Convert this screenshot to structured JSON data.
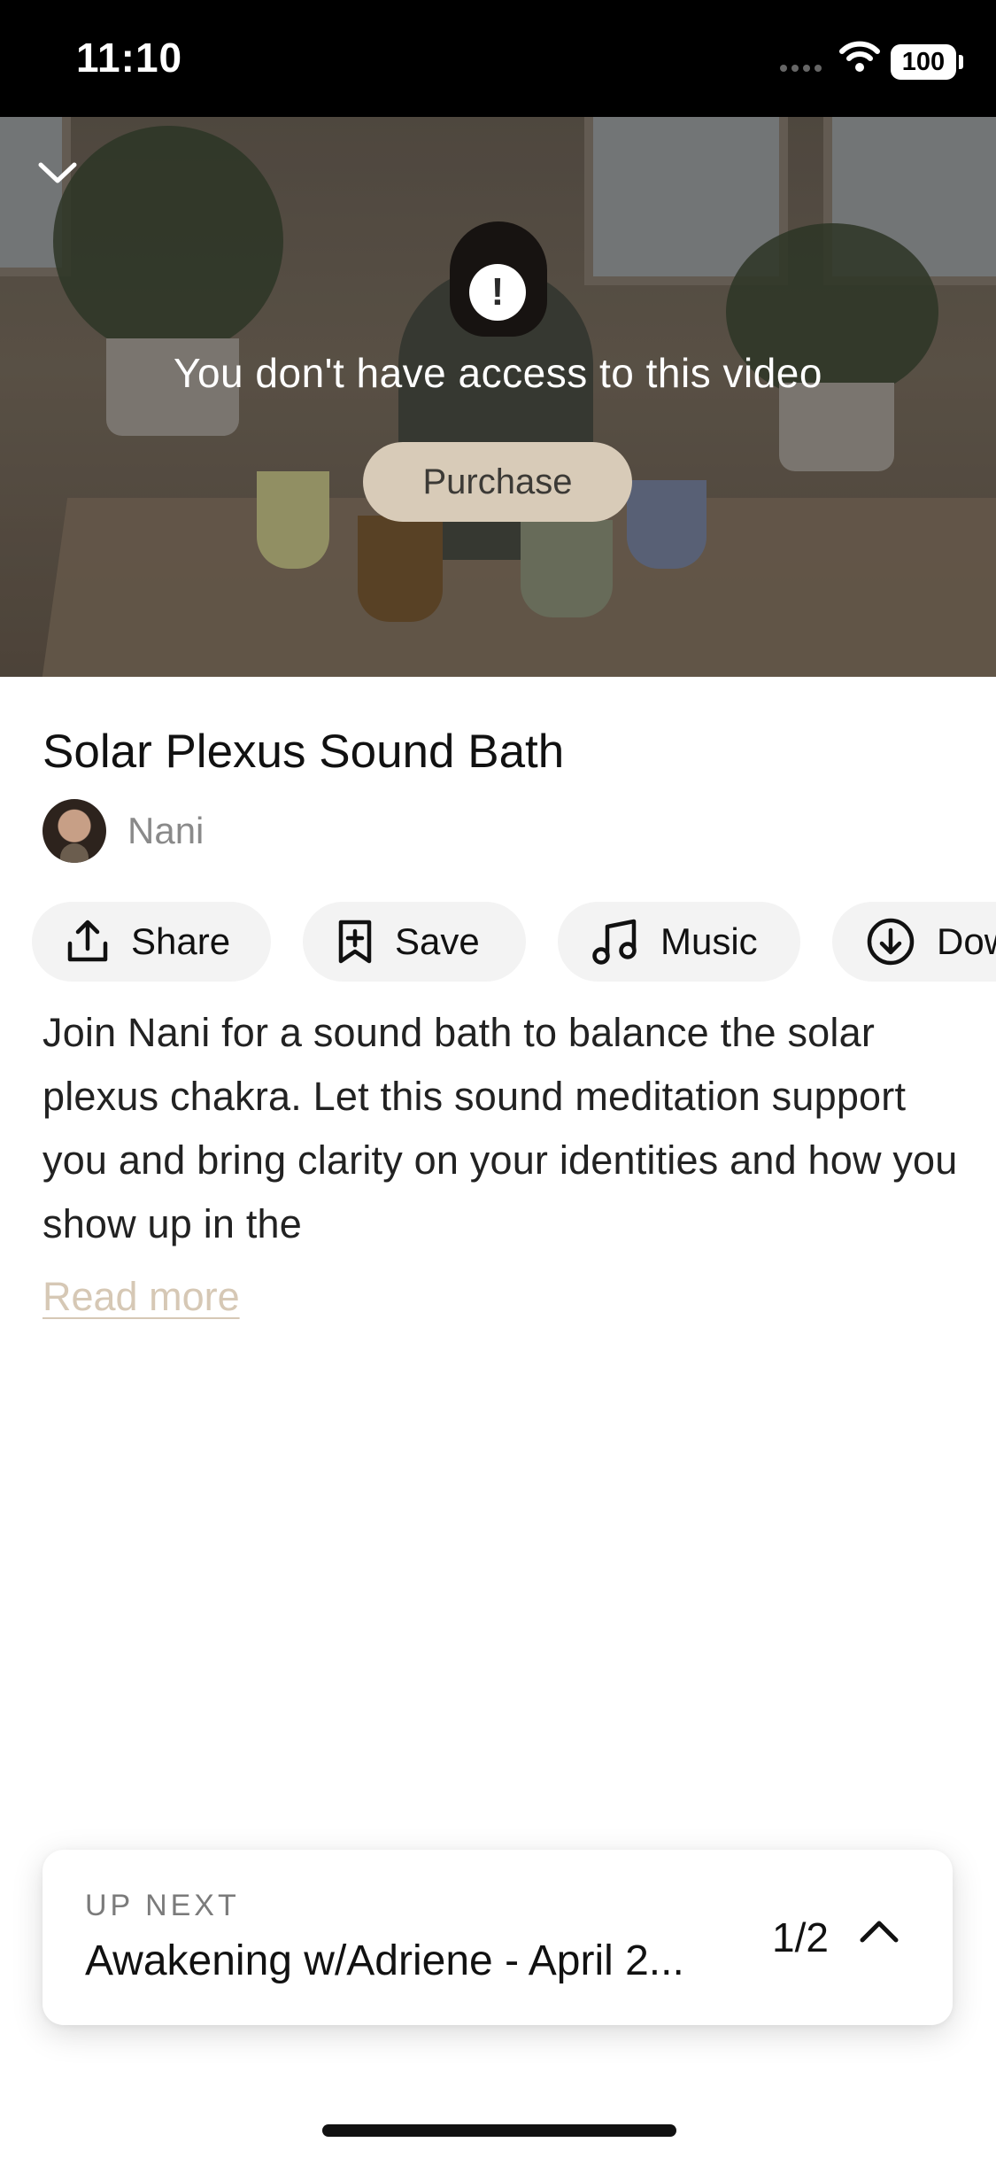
{
  "status_bar": {
    "time": "11:10",
    "battery": "100"
  },
  "video": {
    "message": "You don't have access to this video",
    "purchase_label": "Purchase",
    "alert_symbol": "!"
  },
  "content": {
    "title": "Solar Plexus Sound Bath",
    "author": "Nani",
    "actions": [
      {
        "label": "Share",
        "icon": "share-icon"
      },
      {
        "label": "Save",
        "icon": "bookmark-plus-icon"
      },
      {
        "label": "Music",
        "icon": "music-note-icon"
      },
      {
        "label": "Dow",
        "icon": "download-icon"
      }
    ],
    "description": "Join Nani for a sound bath to balance the solar plexus chakra. Let this sound meditation support you and bring clarity on your identities and how you show up in the",
    "read_more": "Read more"
  },
  "up_next": {
    "label": "UP NEXT",
    "title": "Awakening w/Adriene - April 2...",
    "counter": "1/2"
  },
  "colors": {
    "accent": "#d8cbb8",
    "read_more": "#d6c8b5",
    "chip_bg": "#f3f3f3"
  }
}
